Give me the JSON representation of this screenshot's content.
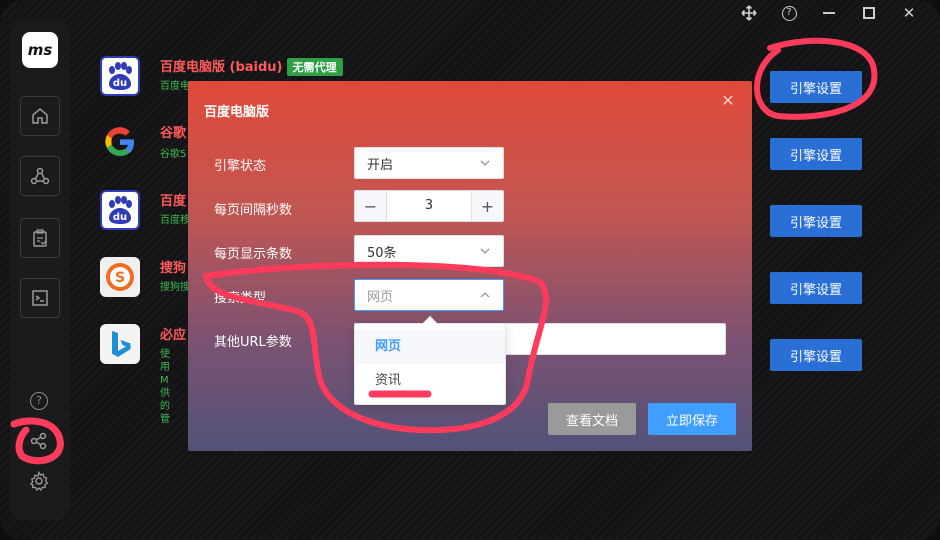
{
  "window_controls": {
    "move_icon": "move-icon",
    "help_glyph": "?",
    "close_glyph": "✕"
  },
  "sidebar": {
    "logo_text": "ms",
    "items": [
      {
        "name": "home"
      },
      {
        "name": "network"
      },
      {
        "name": "clipboard"
      },
      {
        "name": "terminal"
      }
    ],
    "help_glyph": "?"
  },
  "engines": [
    {
      "name": "百度电脑版 (baidu)",
      "tag": "无需代理",
      "desc": "百度电",
      "button": "引擎设置"
    },
    {
      "name": "谷歌",
      "desc": "谷歌5",
      "button": "引擎设置"
    },
    {
      "name": "百度",
      "desc": "百度移",
      "button": "引擎设置"
    },
    {
      "name": "搜狗",
      "desc": "搜狗搜",
      "button": "引擎设置"
    },
    {
      "name": "必应",
      "desc": "使用M\n供的管",
      "button": "引擎设置"
    }
  ],
  "modal": {
    "title": "百度电脑版",
    "close_glyph": "✕",
    "fields": {
      "engine_status": {
        "label": "引擎状态",
        "value": "开启"
      },
      "interval": {
        "label": "每页间隔秒数",
        "value": "3",
        "minus": "−",
        "plus": "+"
      },
      "per_page": {
        "label": "每页显示条数",
        "value": "50条"
      },
      "search_type": {
        "label": "搜索类型",
        "placeholder": "网页"
      },
      "url_params": {
        "label": "其他URL参数",
        "value": ""
      }
    },
    "dropdown_options": [
      {
        "label": "网页",
        "selected": true
      },
      {
        "label": "资讯",
        "selected": false
      }
    ],
    "buttons": {
      "docs": "查看文档",
      "save": "立即保存"
    }
  },
  "colors": {
    "accent": "#409eff",
    "engine_button": "#2a6fd6",
    "annotation": "#ff3b5c",
    "modal_top": "#e0493a",
    "modal_bottom": "#525278"
  }
}
